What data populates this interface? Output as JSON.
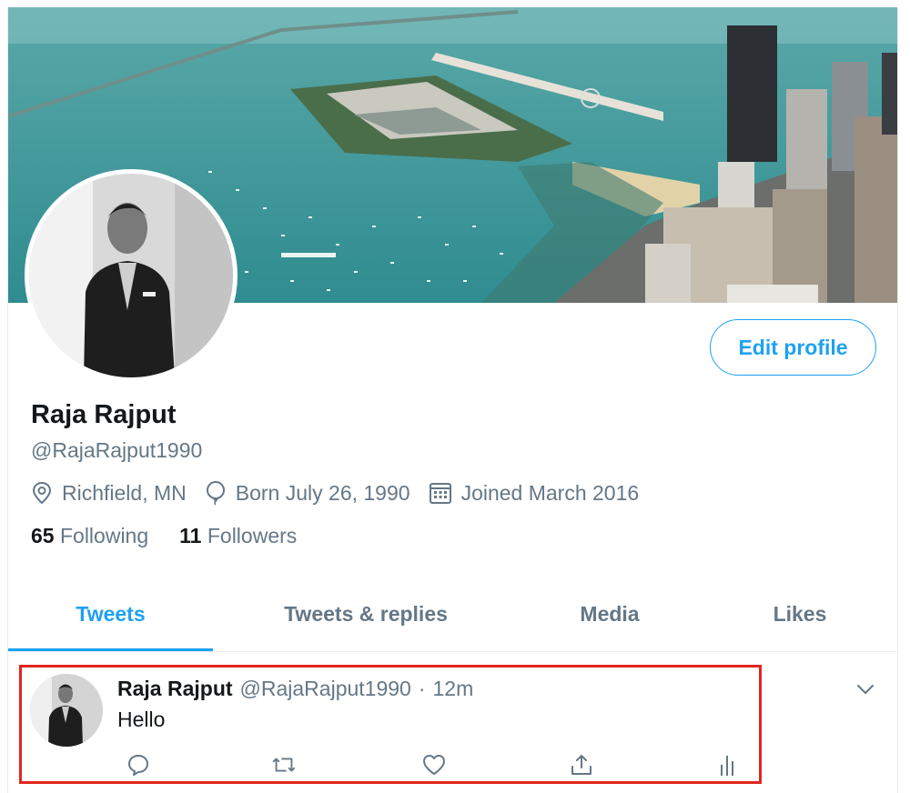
{
  "profile": {
    "name": "Raja Rajput",
    "handle": "@RajaRajput1990",
    "location": "Richfield, MN",
    "birthday": "Born July 26, 1990",
    "joined": "Joined March 2016",
    "following_count": "65",
    "following_label": "Following",
    "followers_count": "11",
    "followers_label": "Followers",
    "edit_button": "Edit profile"
  },
  "tabs": [
    "Tweets",
    "Tweets & replies",
    "Media",
    "Likes"
  ],
  "active_tab": "Tweets",
  "tweet": {
    "name": "Raja Rajput",
    "handle": "@RajaRajput1990",
    "separator": "·",
    "time": "12m",
    "text": "Hello",
    "actions": [
      "reply-icon",
      "retweet-icon",
      "like-icon",
      "share-icon",
      "analytics-icon"
    ]
  },
  "colors": {
    "accent": "#1da1f2",
    "secondary_text": "#657786",
    "highlight_border": "#e0261e"
  }
}
